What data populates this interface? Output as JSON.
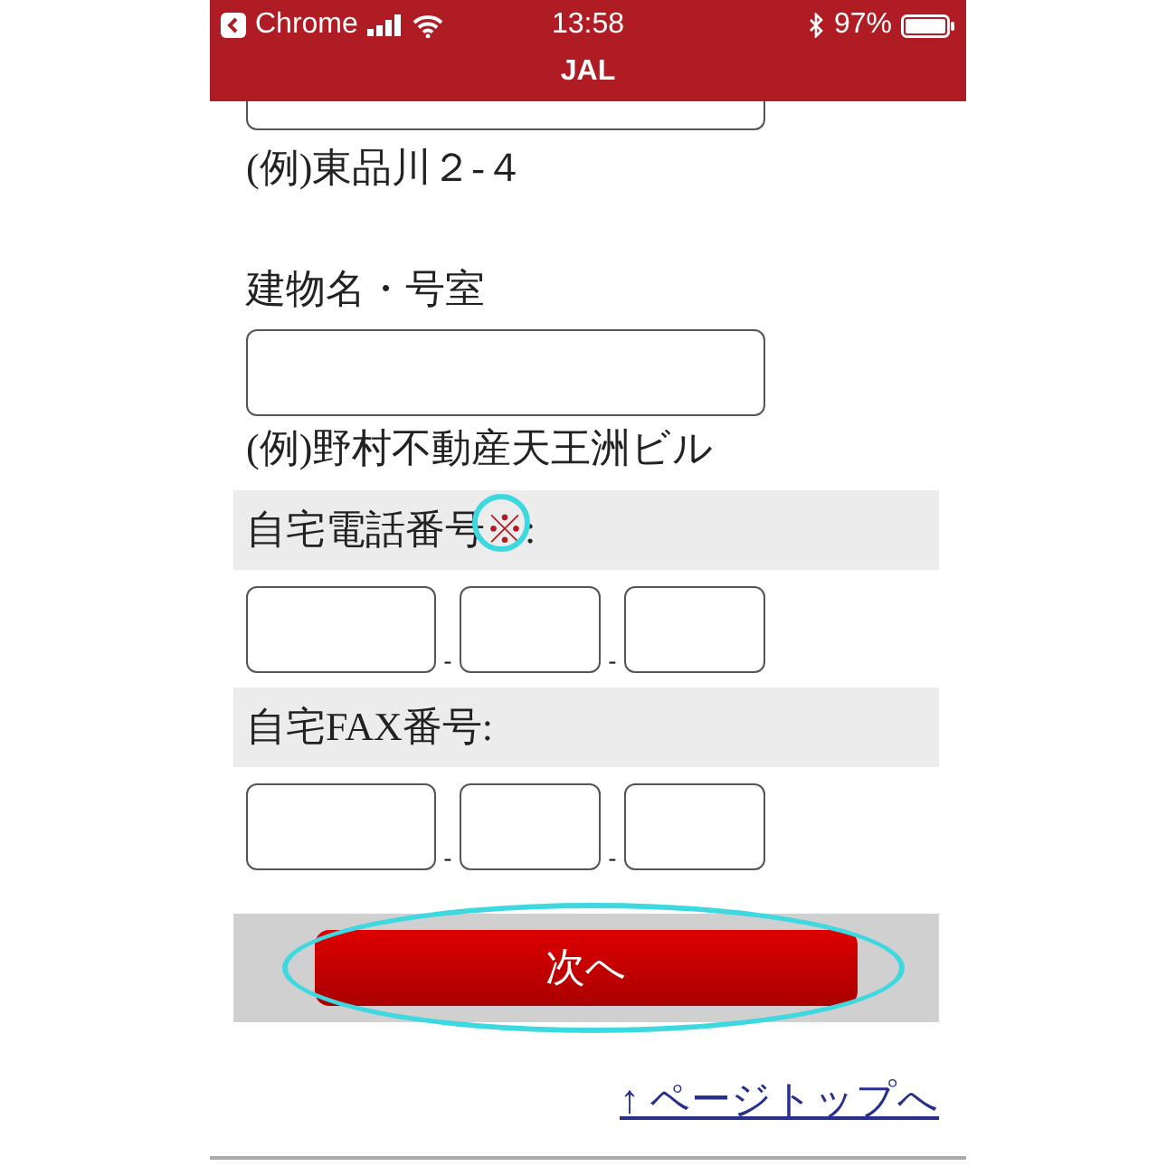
{
  "status_bar": {
    "back_app": "Chrome",
    "time": "13:58",
    "battery": "97%"
  },
  "title": "JAL",
  "address_example": "(例)東品川２-４",
  "building": {
    "label": "建物名・号室",
    "example": "(例)野村不動産天王洲ビル"
  },
  "phone_sections": [
    {
      "label": "自宅電話番号",
      "required_mark": "※",
      "suffix": ":",
      "separators": [
        "-",
        "-"
      ],
      "fields": [
        {
          "kind": "wide"
        },
        {
          "kind": "short"
        },
        {
          "kind": "short"
        }
      ]
    },
    {
      "label": "自宅FAX番号",
      "suffix": ":",
      "separators": [
        "-",
        "-"
      ],
      "fields": [
        {
          "kind": "wide"
        },
        {
          "kind": "short"
        },
        {
          "kind": "short"
        }
      ]
    }
  ],
  "next_button": "次へ",
  "page_top_link": "↑ ページトップへ"
}
